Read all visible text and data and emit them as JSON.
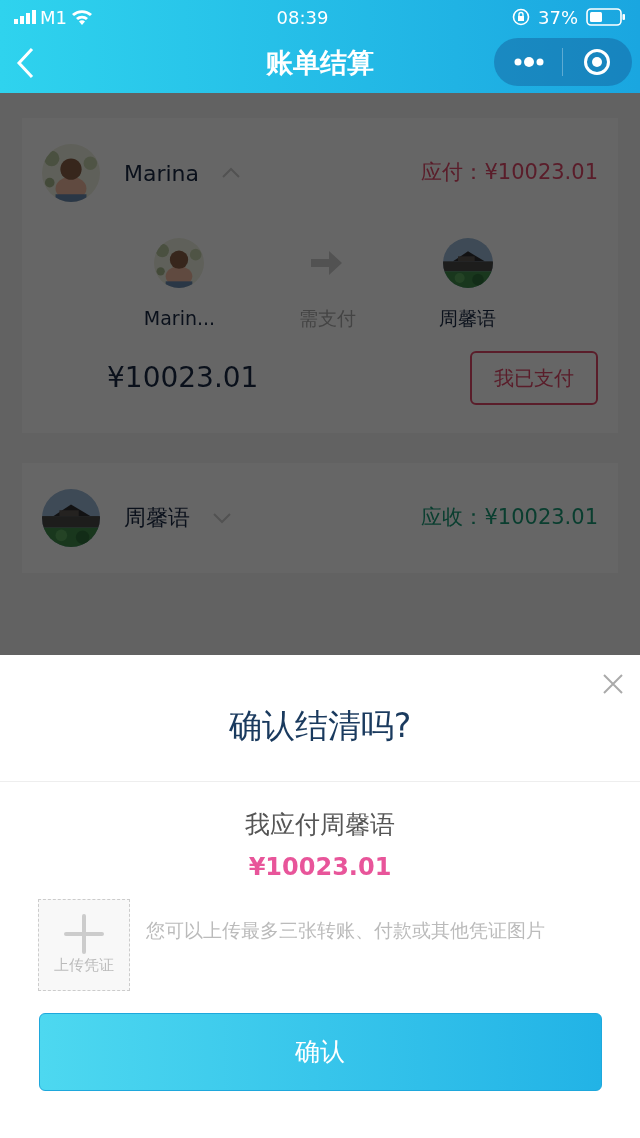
{
  "status_bar": {
    "carrier": "M1",
    "time": "08:39",
    "battery": "37%"
  },
  "nav": {
    "title": "账单结算"
  },
  "bills": [
    {
      "kind": "pay",
      "name": "Marina",
      "expanded": true,
      "amount_label": "应付：¥10023.01",
      "detail": {
        "from": "Marin...",
        "action": "需支付",
        "to": "周馨语",
        "amount": "¥10023.01",
        "button": "我已支付"
      }
    },
    {
      "kind": "receive",
      "name": "周馨语",
      "expanded": false,
      "amount_label": "应收：¥10023.01"
    }
  ],
  "dialog": {
    "title": "确认结清吗?",
    "subtitle": "我应付周馨语",
    "amount": "¥10023.01",
    "upload_label": "上传凭证",
    "hint": "您可以上传最多三张转账、付款或其他凭证图片",
    "confirm": "确认"
  }
}
